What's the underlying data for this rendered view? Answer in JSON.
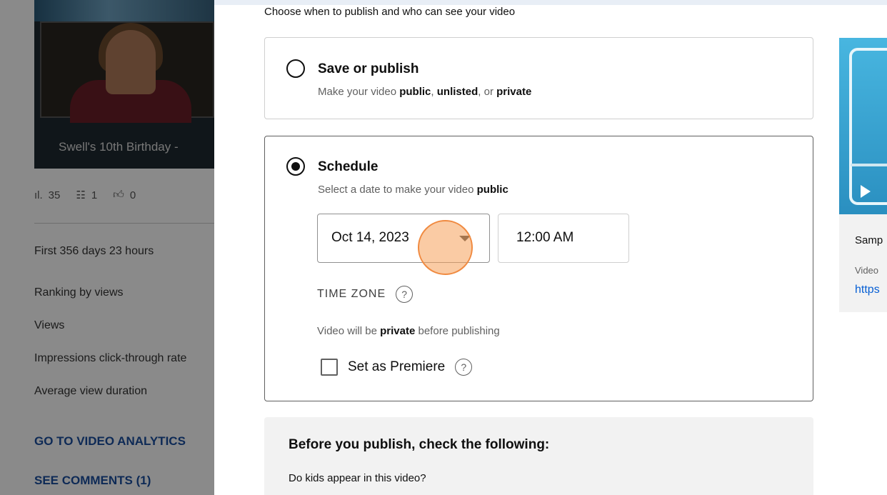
{
  "background": {
    "video_title": "Swell's 10th Birthday -",
    "stats": {
      "views": "35",
      "comments": "1",
      "likes": "0"
    },
    "lines": [
      "First 356 days 23 hours",
      "Ranking by views",
      "Views",
      "Impressions click-through rate",
      "Average view duration"
    ],
    "links": [
      "GO TO VIDEO ANALYTICS",
      "SEE COMMENTS (1)"
    ]
  },
  "side_card": {
    "label1": "Samp",
    "label2": "Video",
    "label3": "https"
  },
  "dialog": {
    "subtitle": "Choose when to publish and who can see your video",
    "save_option": {
      "title": "Save or publish",
      "desc_prefix": "Make your video ",
      "public": "public",
      "comma1": ", ",
      "unlisted": "unlisted",
      "or": ", or ",
      "private": "private"
    },
    "schedule_option": {
      "title": "Schedule",
      "desc_prefix": "Select a date to make your video ",
      "public": "public",
      "date": "Oct 14, 2023",
      "time": "12:00 AM",
      "timezone_label": "TIME ZONE",
      "help_glyph": "?",
      "privacy_prefix": "Video will be ",
      "privacy_word": "private",
      "privacy_suffix": " before publishing",
      "premiere_label": "Set as Premiere"
    },
    "checklist": {
      "heading": "Before you publish, check the following:",
      "question": "Do kids appear in this video?"
    }
  },
  "colors": {
    "accent_link": "#065fd4",
    "cursor": "#f08a40"
  }
}
